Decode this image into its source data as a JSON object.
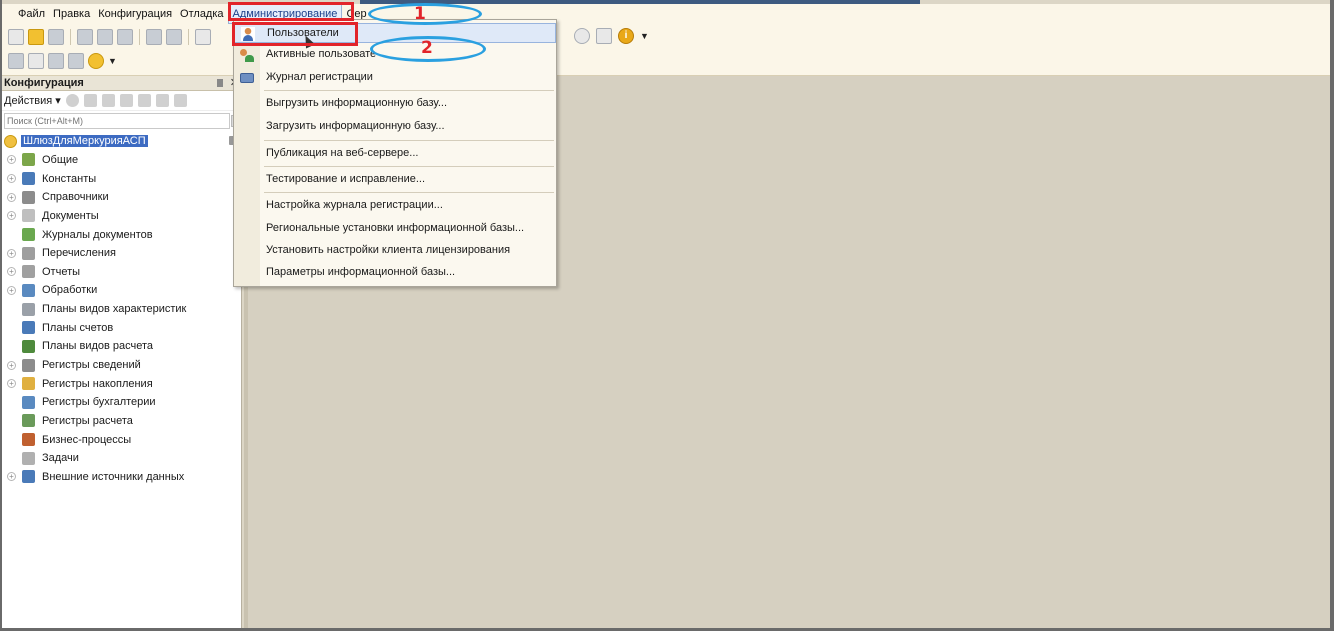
{
  "menubar": {
    "items": [
      {
        "label": "Файл"
      },
      {
        "label": "Правка"
      },
      {
        "label": "Конфигурация"
      },
      {
        "label": "Отладка"
      },
      {
        "label": "Администрирование"
      },
      {
        "label": "Сер"
      }
    ]
  },
  "admin_menu": {
    "items": [
      {
        "label": "Пользователи",
        "icon": "user-icon",
        "highlighted": true
      },
      {
        "label": "Активные пользовате",
        "icon": "active-users-icon"
      },
      {
        "label": "Журнал регистрации",
        "icon": "journal-icon"
      },
      {
        "label": "Выгрузить информационную базу..."
      },
      {
        "label": "Загрузить информационную базу..."
      },
      {
        "label": "Публикация на веб-сервере..."
      },
      {
        "label": "Тестирование и исправление..."
      },
      {
        "label": "Настройка журнала регистрации..."
      },
      {
        "label": "Региональные установки информационной базы..."
      },
      {
        "label": "Установить настройки клиента лицензирования"
      },
      {
        "label": "Параметры информационной базы..."
      }
    ]
  },
  "config_panel": {
    "title": "Конфигурация",
    "close": "✕",
    "actions_label": "Действия ▾",
    "search_placeholder": "Поиск (Ctrl+Alt+M)",
    "root": "ШлюзДляМеркурияАСП",
    "items": [
      {
        "label": "Общие",
        "expandable": true,
        "color": "#7ca64a"
      },
      {
        "label": "Константы",
        "expandable": true,
        "color": "#4a7ab8"
      },
      {
        "label": "Справочники",
        "expandable": true,
        "color": "#8c8c8c"
      },
      {
        "label": "Документы",
        "expandable": true,
        "color": "#bfbfbf"
      },
      {
        "label": "Журналы документов",
        "expandable": false,
        "color": "#6aa84f"
      },
      {
        "label": "Перечисления",
        "expandable": true,
        "color": "#9e9e9e"
      },
      {
        "label": "Отчеты",
        "expandable": true,
        "color": "#a0a0a0"
      },
      {
        "label": "Обработки",
        "expandable": true,
        "color": "#5a8ac0"
      },
      {
        "label": "Планы видов характеристик",
        "expandable": false,
        "color": "#9aa0a8"
      },
      {
        "label": "Планы счетов",
        "expandable": false,
        "color": "#4a7ab8"
      },
      {
        "label": "Планы видов расчета",
        "expandable": false,
        "color": "#4e8a3c"
      },
      {
        "label": "Регистры сведений",
        "expandable": true,
        "color": "#8c8c8c"
      },
      {
        "label": "Регистры накопления",
        "expandable": true,
        "color": "#e0b040"
      },
      {
        "label": "Регистры бухгалтерии",
        "expandable": false,
        "color": "#5a8ac0"
      },
      {
        "label": "Регистры расчета",
        "expandable": false,
        "color": "#6a9a5a"
      },
      {
        "label": "Бизнес-процессы",
        "expandable": false,
        "color": "#c06030"
      },
      {
        "label": "Задачи",
        "expandable": false,
        "color": "#b0b0b0"
      },
      {
        "label": "Внешние источники данных",
        "expandable": true,
        "color": "#4a7ab8"
      }
    ]
  },
  "annotations": {
    "label_1": "1",
    "label_2": "2"
  }
}
